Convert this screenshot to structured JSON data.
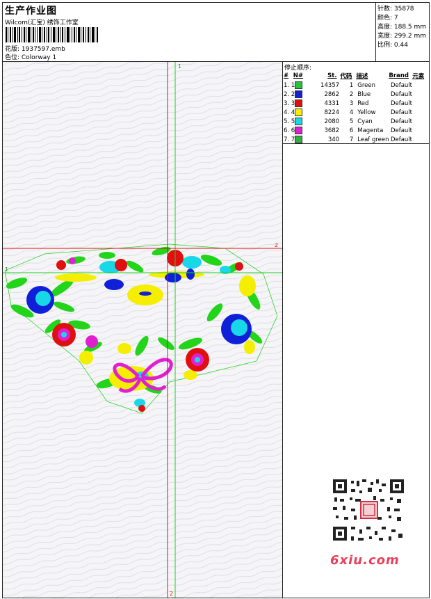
{
  "header": {
    "title": "生产作业图",
    "subtitle": "Wilcom(汇宝) 绣饰工作室",
    "design_label": "花版: 1937597.emb",
    "colorway_label": "色位:  Colorway 1"
  },
  "stats": {
    "stitches": "针数: 35878",
    "colors": "颜色: 7",
    "height": "高度: 188.5 mm",
    "width": "宽度: 299.2 mm",
    "scale": "比例: 0.44"
  },
  "stops": {
    "title": "停止顺序:",
    "headers": [
      "#",
      "N#",
      "St.",
      "代码",
      "描述",
      "Brand",
      "元素"
    ],
    "rows": [
      {
        "num": "1. 1",
        "color": "#22c43a",
        "st": "14357",
        "code": "1",
        "desc": "Green",
        "brand": "Default"
      },
      {
        "num": "2. 2",
        "color": "#1020d8",
        "st": "2862",
        "code": "2",
        "desc": "Blue",
        "brand": "Default"
      },
      {
        "num": "3. 3",
        "color": "#e01010",
        "st": "4331",
        "code": "3",
        "desc": "Red",
        "brand": "Default"
      },
      {
        "num": "4. 4",
        "color": "#f4f000",
        "st": "8224",
        "code": "4",
        "desc": "Yellow",
        "brand": "Default"
      },
      {
        "num": "5. 5",
        "color": "#18d8e8",
        "st": "2080",
        "code": "5",
        "desc": "Cyan",
        "brand": "Default"
      },
      {
        "num": "6. 6",
        "color": "#e020d0",
        "st": "3682",
        "code": "6",
        "desc": "Magenta",
        "brand": "Default"
      },
      {
        "num": "7. 7",
        "color": "#30b040",
        "st": "340",
        "code": "7",
        "desc": "Leaf green",
        "brand": "Default"
      }
    ]
  },
  "guides": {
    "v_green": "1",
    "v_red": "2",
    "h_red": "2",
    "h_green": "1"
  },
  "watermark": {
    "text": "6xiu.com"
  }
}
